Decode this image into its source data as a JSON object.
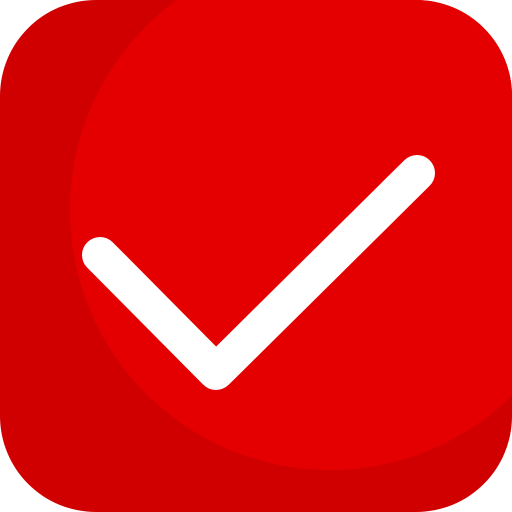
{
  "icon": {
    "name": "checkmark-app-icon",
    "glyph": "check-icon",
    "colors": {
      "background": "#ffffff",
      "tile_dark": "#d10000",
      "tile_light": "#e40000",
      "check": "#ffffff"
    }
  }
}
